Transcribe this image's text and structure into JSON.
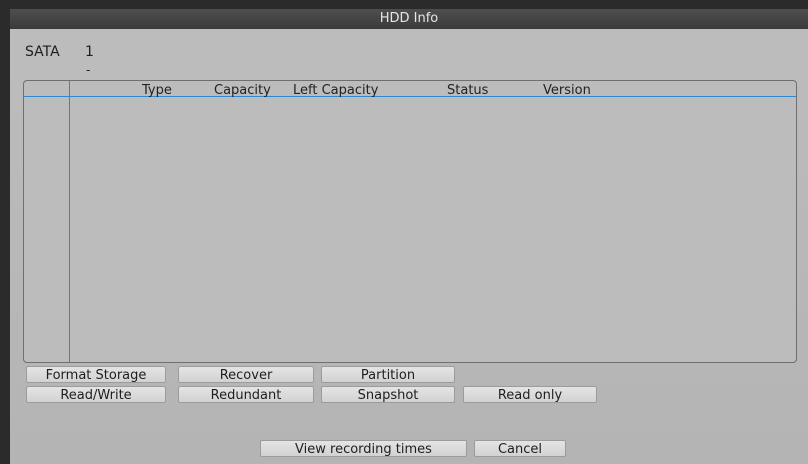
{
  "window": {
    "title": "HDD Info"
  },
  "disk": {
    "label": "SATA",
    "number": "1",
    "dash": "-"
  },
  "table": {
    "columns": [
      "Type",
      "Capacity",
      "Left Capacity",
      "Status",
      "Version"
    ]
  },
  "buttons": {
    "format_storage": "Format Storage",
    "recover": "Recover",
    "partition": "Partition",
    "read_write": "Read/Write",
    "redundant": "Redundant",
    "snapshot": "Snapshot",
    "read_only": "Read only",
    "view_recording_times": "View recording times",
    "cancel": "Cancel"
  }
}
